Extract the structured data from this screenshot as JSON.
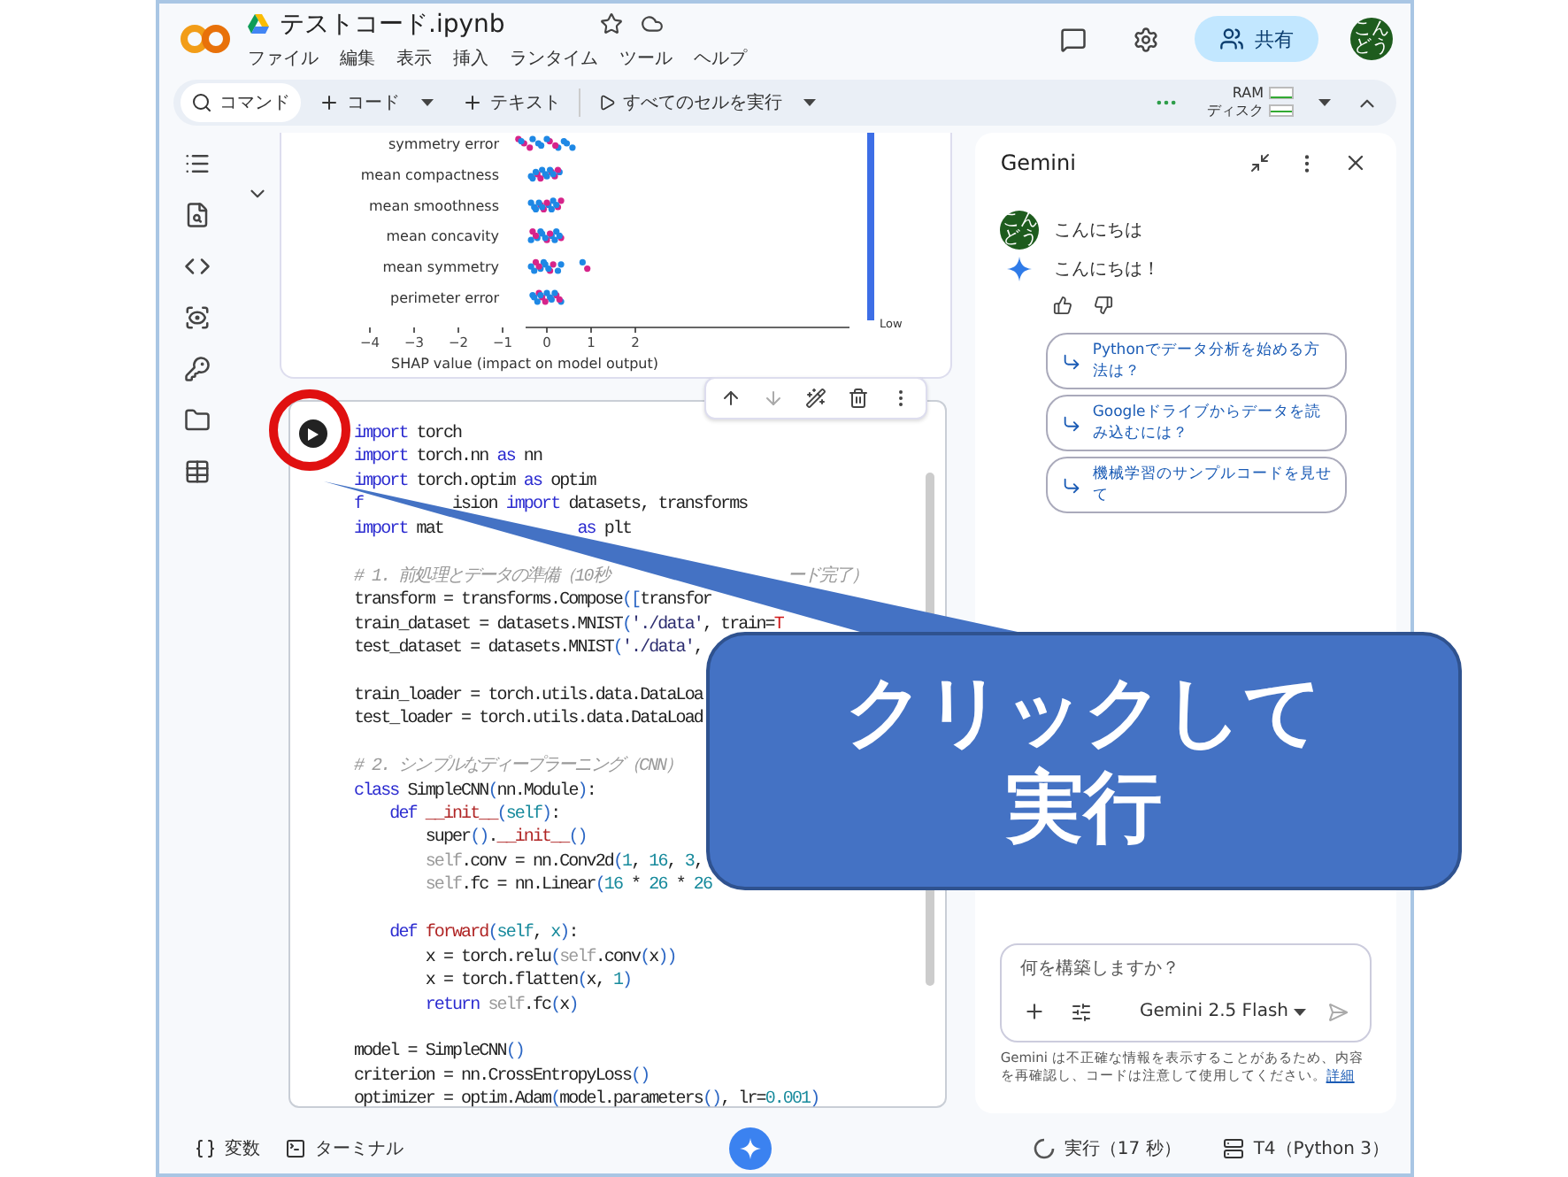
{
  "app": {
    "title": "テストコード.ipynb",
    "menu": [
      "ファイル",
      "編集",
      "表示",
      "挿入",
      "ランタイム",
      "ツール",
      "ヘルプ"
    ],
    "share": "共有",
    "avatar": [
      "こん",
      "どう"
    ]
  },
  "toolbar": {
    "items": [
      {
        "kind": "search",
        "label": "コマンド",
        "dropdown": false
      },
      {
        "kind": "add",
        "label": "コード",
        "dropdown": true
      },
      {
        "kind": "add",
        "label": "テキスト",
        "dropdown": false
      },
      {
        "kind": "run",
        "label": "すべてのセルを実行",
        "dropdown": true
      }
    ],
    "ram": "RAM",
    "disk": "ディスク"
  },
  "shap": {
    "features": [
      "symmetry error",
      "mean compactness",
      "mean smoothness",
      "mean concavity",
      "mean symmetry",
      "perimeter error"
    ],
    "xticks": [
      "−4",
      "−3",
      "−2",
      "−1",
      "0",
      "1",
      "2"
    ],
    "xlabel": "SHAP value (impact on model output)",
    "colorbar_label": "Low"
  },
  "code": [
    {
      "kind": "code",
      "segs": [
        {
          "kind": "kw",
          "text": "import"
        },
        {
          "kind": "p",
          "text": " torch"
        }
      ]
    },
    {
      "kind": "code",
      "segs": [
        {
          "kind": "kw",
          "text": "import"
        },
        {
          "kind": "p",
          "text": " torch.nn "
        },
        {
          "kind": "kw",
          "text": "as"
        },
        {
          "kind": "p",
          "text": " nn"
        }
      ]
    },
    {
      "kind": "code",
      "segs": [
        {
          "kind": "kw",
          "text": "import"
        },
        {
          "kind": "p",
          "text": " torch.optim "
        },
        {
          "kind": "kw",
          "text": "as"
        },
        {
          "kind": "p",
          "text": " optim"
        }
      ]
    },
    {
      "kind": "code",
      "segs": [
        {
          "kind": "kw",
          "text": "f"
        },
        {
          "kind": "p",
          "text": "          ision "
        },
        {
          "kind": "kw",
          "text": "import"
        },
        {
          "kind": "p",
          "text": " datasets, transforms"
        }
      ]
    },
    {
      "kind": "code",
      "segs": [
        {
          "kind": "kw",
          "text": "import"
        },
        {
          "kind": "p",
          "text": " mat               "
        },
        {
          "kind": "kw",
          "text": "as"
        },
        {
          "kind": "p",
          "text": " plt"
        }
      ]
    },
    {
      "kind": "blank"
    },
    {
      "kind": "code",
      "segs": [
        {
          "kind": "c",
          "text": "# 1. 前処理とデータの準備（10秒                    ード完了）"
        }
      ]
    },
    {
      "kind": "code",
      "segs": [
        {
          "kind": "p",
          "text": "transform = transforms.Compose"
        },
        {
          "kind": "b",
          "text": "(["
        },
        {
          "kind": "p",
          "text": "transfor"
        }
      ]
    },
    {
      "kind": "code",
      "segs": [
        {
          "kind": "p",
          "text": "train_dataset = datasets.MNIST"
        },
        {
          "kind": "b",
          "text": "("
        },
        {
          "kind": "s",
          "text": "'./data'"
        },
        {
          "kind": "p",
          "text": ", train="
        },
        {
          "kind": "k",
          "text": "T"
        }
      ]
    },
    {
      "kind": "code",
      "segs": [
        {
          "kind": "p",
          "text": "test_dataset = datasets.MNIST"
        },
        {
          "kind": "b",
          "text": "("
        },
        {
          "kind": "s",
          "text": "'./data'"
        },
        {
          "kind": "p",
          "text": ","
        }
      ]
    },
    {
      "kind": "blank"
    },
    {
      "kind": "code",
      "segs": [
        {
          "kind": "p",
          "text": "train_loader = torch.utils.data.DataLoa"
        }
      ]
    },
    {
      "kind": "code",
      "segs": [
        {
          "kind": "p",
          "text": "test_loader = torch.utils.data.DataLoad"
        }
      ]
    },
    {
      "kind": "blank"
    },
    {
      "kind": "code",
      "segs": [
        {
          "kind": "c",
          "text": "# 2. シンプルなディープラーニング（CNN）"
        }
      ]
    },
    {
      "kind": "code",
      "segs": [
        {
          "kind": "kw",
          "text": "class"
        },
        {
          "kind": "p",
          "text": " SimpleCNN"
        },
        {
          "kind": "b",
          "text": "("
        },
        {
          "kind": "p",
          "text": "nn.Module"
        },
        {
          "kind": "b",
          "text": ")"
        },
        {
          "kind": "p",
          "text": ":"
        }
      ]
    },
    {
      "kind": "code",
      "segs": [
        {
          "kind": "kw",
          "text": "    def"
        },
        {
          "kind": "f",
          "text": " __init__"
        },
        {
          "kind": "b",
          "text": "("
        },
        {
          "kind": "n",
          "text": "self"
        },
        {
          "kind": "b",
          "text": ")"
        },
        {
          "kind": "p",
          "text": ":"
        }
      ]
    },
    {
      "kind": "code",
      "segs": [
        {
          "kind": "p",
          "text": "        super"
        },
        {
          "kind": "b",
          "text": "()"
        },
        {
          "kind": "p",
          "text": "."
        },
        {
          "kind": "f",
          "text": "__init__"
        },
        {
          "kind": "b",
          "text": "()"
        }
      ]
    },
    {
      "kind": "code",
      "segs": [
        {
          "kind": "sf",
          "text": "        self"
        },
        {
          "kind": "p",
          "text": ".conv = nn.Conv2d"
        },
        {
          "kind": "b",
          "text": "("
        },
        {
          "kind": "n",
          "text": "1"
        },
        {
          "kind": "p",
          "text": ", "
        },
        {
          "kind": "n",
          "text": "16"
        },
        {
          "kind": "p",
          "text": ", "
        },
        {
          "kind": "n",
          "text": "3"
        },
        {
          "kind": "p",
          "text": ","
        }
      ]
    },
    {
      "kind": "code",
      "segs": [
        {
          "kind": "sf",
          "text": "        self"
        },
        {
          "kind": "p",
          "text": ".fc = nn.Linear"
        },
        {
          "kind": "b",
          "text": "("
        },
        {
          "kind": "n",
          "text": "16"
        },
        {
          "kind": "p",
          "text": " * "
        },
        {
          "kind": "n",
          "text": "26"
        },
        {
          "kind": "p",
          "text": " * "
        },
        {
          "kind": "n",
          "text": "26"
        }
      ]
    },
    {
      "kind": "blank"
    },
    {
      "kind": "code",
      "segs": [
        {
          "kind": "kw",
          "text": "    def"
        },
        {
          "kind": "f",
          "text": " forward"
        },
        {
          "kind": "b",
          "text": "("
        },
        {
          "kind": "n",
          "text": "self"
        },
        {
          "kind": "p",
          "text": ", "
        },
        {
          "kind": "n",
          "text": "x"
        },
        {
          "kind": "b",
          "text": ")"
        },
        {
          "kind": "p",
          "text": ":"
        }
      ]
    },
    {
      "kind": "code",
      "segs": [
        {
          "kind": "p",
          "text": "        x = torch.relu"
        },
        {
          "kind": "b",
          "text": "("
        },
        {
          "kind": "sf",
          "text": "self"
        },
        {
          "kind": "p",
          "text": ".conv"
        },
        {
          "kind": "b",
          "text": "("
        },
        {
          "kind": "p",
          "text": "x"
        },
        {
          "kind": "b",
          "text": "))"
        }
      ]
    },
    {
      "kind": "code",
      "segs": [
        {
          "kind": "p",
          "text": "        x = torch.flatten"
        },
        {
          "kind": "b",
          "text": "("
        },
        {
          "kind": "p",
          "text": "x, "
        },
        {
          "kind": "n",
          "text": "1"
        },
        {
          "kind": "b",
          "text": ")"
        }
      ]
    },
    {
      "kind": "code",
      "segs": [
        {
          "kind": "kw",
          "text": "        return"
        },
        {
          "kind": "sf",
          "text": " self"
        },
        {
          "kind": "p",
          "text": ".fc"
        },
        {
          "kind": "b",
          "text": "("
        },
        {
          "kind": "p",
          "text": "x"
        },
        {
          "kind": "b",
          "text": ")"
        }
      ]
    },
    {
      "kind": "blank"
    },
    {
      "kind": "code",
      "segs": [
        {
          "kind": "p",
          "text": "model = SimpleCNN"
        },
        {
          "kind": "b",
          "text": "()"
        }
      ]
    },
    {
      "kind": "code",
      "segs": [
        {
          "kind": "p",
          "text": "criterion = nn.CrossEntropyLoss"
        },
        {
          "kind": "b",
          "text": "()"
        }
      ]
    },
    {
      "kind": "code",
      "segs": [
        {
          "kind": "p",
          "text": "optimizer = optim.Adam"
        },
        {
          "kind": "b",
          "text": "("
        },
        {
          "kind": "p",
          "text": "model.parameters"
        },
        {
          "kind": "b",
          "text": "()"
        },
        {
          "kind": "p",
          "text": ", lr="
        },
        {
          "kind": "n",
          "text": "0.001"
        },
        {
          "kind": "b",
          "text": ")"
        }
      ]
    }
  ],
  "gemini": {
    "title": "Gemini",
    "messages": [
      {
        "kind": "user",
        "avatar": [
          "こん",
          "どう"
        ],
        "text": "こんにちは"
      },
      {
        "kind": "model",
        "text": "こんにちは！"
      }
    ],
    "suggestions": [
      "Pythonでデータ分析を始める方法は？",
      "Googleドライブからデータを読み込むには？",
      "機械学習のサンプルコードを見せて"
    ],
    "placeholder": "何を構築しますか？",
    "model": "Gemini 2.5 Flash",
    "disclaimer": "Gemini は不正確な情報を表示することがあるため、内容を再確認し、コードは注意して使用してください。",
    "link": "詳細"
  },
  "status": {
    "variables": "変数",
    "terminal": "ターミナル",
    "running": "実行（17 秒）",
    "runtime": "T4（Python 3）"
  },
  "annotation": {
    "lines": [
      "クリックして",
      "実行"
    ]
  }
}
